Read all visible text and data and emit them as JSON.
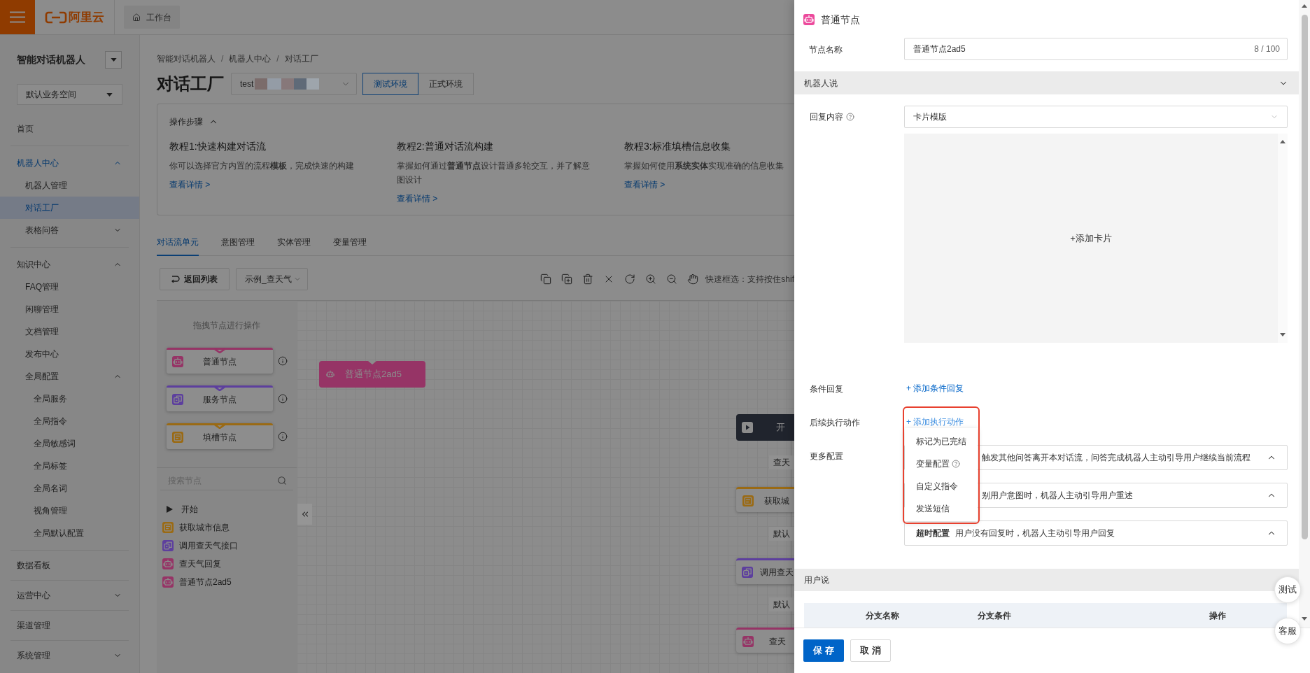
{
  "top_bar": {
    "logo_text": "阿里云",
    "tab": "工作台"
  },
  "sidebar": {
    "title": "智能对话机器人",
    "workspace": "默认业务空间",
    "nav": [
      {
        "label": "首页",
        "kind": "page",
        "selected": false
      },
      {
        "label": "机器人中心",
        "kind": "group",
        "selected": false,
        "expanded": true,
        "children": [
          {
            "label": "机器人管理",
            "kind": "page",
            "selected": false
          },
          {
            "label": "对话工厂",
            "kind": "page",
            "selected": true
          },
          {
            "label": "表格问答",
            "kind": "group",
            "selected": false,
            "expanded": false
          }
        ]
      },
      {
        "label": "知识中心",
        "kind": "group",
        "selected": false,
        "expanded": true,
        "children": [
          {
            "label": "FAQ管理",
            "kind": "page",
            "selected": false
          },
          {
            "label": "闲聊管理",
            "kind": "page",
            "selected": false
          },
          {
            "label": "文档管理",
            "kind": "page",
            "selected": false
          },
          {
            "label": "发布中心",
            "kind": "page",
            "selected": false
          },
          {
            "label": "全局配置",
            "kind": "group",
            "selected": false,
            "expanded": true,
            "children": [
              {
                "label": "全局服务",
                "kind": "page",
                "selected": false
              },
              {
                "label": "全局指令",
                "kind": "page",
                "selected": false
              },
              {
                "label": "全局敏感词",
                "kind": "page",
                "selected": false
              },
              {
                "label": "全局标签",
                "kind": "page",
                "selected": false
              },
              {
                "label": "全局名词",
                "kind": "page",
                "selected": false
              },
              {
                "label": "视角管理",
                "kind": "page",
                "selected": false
              },
              {
                "label": "全局默认配置",
                "kind": "page",
                "selected": false
              }
            ]
          }
        ]
      },
      {
        "label": "数据看板",
        "kind": "page",
        "selected": false
      },
      {
        "label": "运营中心",
        "kind": "group",
        "selected": false,
        "expanded": false
      },
      {
        "label": "渠道管理",
        "kind": "page",
        "selected": false
      },
      {
        "label": "系统管理",
        "kind": "group",
        "selected": false,
        "expanded": false
      }
    ]
  },
  "main": {
    "breadcrumb": {
      "items": [
        "智能对话机器人",
        "机器人中心",
        "对话工厂"
      ],
      "separator": "/"
    },
    "page_title": "对话工厂",
    "bot_select": {
      "value": "test"
    },
    "environments": [
      {
        "label": "测试环境",
        "selected": true
      },
      {
        "label": "正式环境",
        "selected": false
      }
    ],
    "guide": {
      "title": "操作步骤",
      "expanded": true,
      "tutorials": [
        {
          "title": "教程1:快速构建对话流",
          "description": "你可以选择官方内置的流程**模板**，完成快速的构建",
          "link": "查看详情 >"
        },
        {
          "title": "教程2:普通对话流构建",
          "description": "掌握如何通过**普通节点**设计普通多轮交互，并了解意图设计",
          "link": "查看详情 >"
        },
        {
          "title": "教程3:标准填槽信息收集",
          "description": "掌握如何使用**系统实体**实现准确的信息收集",
          "link": "查看详情 >"
        }
      ]
    },
    "tabs": [
      {
        "label": "对话流单元",
        "selected": true
      },
      {
        "label": "意图管理",
        "selected": false
      },
      {
        "label": "实体管理",
        "selected": false
      },
      {
        "label": "变量管理",
        "selected": false
      }
    ],
    "toolbar": {
      "back_button": "返回列表",
      "flow_select": {
        "value": "示例_查天气"
      },
      "hint": "快速框选：支持按住shif"
    },
    "node_palette": {
      "hint": "拖拽节点进行操作",
      "nodes": [
        {
          "label": "普通节点",
          "kind": "dialog",
          "color": "#963466"
        },
        {
          "label": "服务节点",
          "kind": "service",
          "color": "#5d3f9e"
        },
        {
          "label": "填槽节点",
          "kind": "slot",
          "color": "#9a6a14"
        }
      ],
      "search": {
        "placeholder": "搜索节点"
      },
      "tree": [
        {
          "label": "开始",
          "kind": "start"
        },
        {
          "label": "获取城市信息",
          "kind": "slot",
          "color": "#9a6a14"
        },
        {
          "label": "调用查天气接口",
          "kind": "service",
          "color": "#5d3f9e"
        },
        {
          "label": "查天气回复",
          "kind": "dialog",
          "color": "#963466"
        },
        {
          "label": "普通节点2ad5",
          "kind": "dialog",
          "color": "#963466"
        }
      ]
    },
    "canvas": {
      "nodes": [
        {
          "label": "普通节点2ad5",
          "kind": "dialog",
          "selected": true,
          "color": "#963466"
        },
        {
          "label": "开",
          "kind": "start",
          "selected": false
        },
        {
          "label": "获取城",
          "kind": "slot",
          "selected": false,
          "color": "#9a6a14"
        },
        {
          "label": "调用查天",
          "kind": "service",
          "selected": false,
          "color": "#5d3f9e"
        },
        {
          "label": "查天",
          "kind": "dialog",
          "selected": false,
          "color": "#963466"
        }
      ],
      "edge_labels": [
        "查天",
        "默认",
        "默认"
      ]
    }
  },
  "drawer": {
    "kind": "dialog",
    "title": "普通节点",
    "node_name": {
      "label": "节点名称",
      "value": "普通节点2ad5",
      "counter": "8 / 100"
    },
    "robot_says": {
      "title": "机器人说",
      "expanded": true,
      "reply": {
        "label": "回复内容",
        "value": "卡片模版",
        "add_card": "+添加卡片"
      },
      "conditional_reply": {
        "label": "条件回复",
        "link": "+ 添加条件回复"
      },
      "follow_up": {
        "label": "后续执行动作",
        "link": "+ 添加执行动作",
        "menu": [
          {
            "label": "标记为已完结",
            "help": false
          },
          {
            "label": "变量配置",
            "help": true
          },
          {
            "label": "自定义指令",
            "help": false
          },
          {
            "label": "发送短信",
            "help": false
          }
        ]
      },
      "more_config": {
        "label": "更多配置",
        "panels": [
          {
            "description": "触发其他问答离开本对话流，问答完成机器人主动引导用户继续当前流程"
          },
          {
            "description": "别用户意图时，机器人主动引导用户重述"
          },
          {
            "title": "超时配置",
            "description": "用户没有回复时，机器人主动引导用户回复"
          }
        ]
      }
    },
    "user_says": {
      "title": "用户说",
      "columns": [
        "分支名称",
        "分支条件",
        "操作"
      ]
    },
    "footer_buttons": [
      {
        "label": "保存",
        "kind": "primary"
      },
      {
        "label": "取消",
        "kind": "default"
      }
    ],
    "float_buttons": [
      "测试",
      "客服"
    ]
  }
}
